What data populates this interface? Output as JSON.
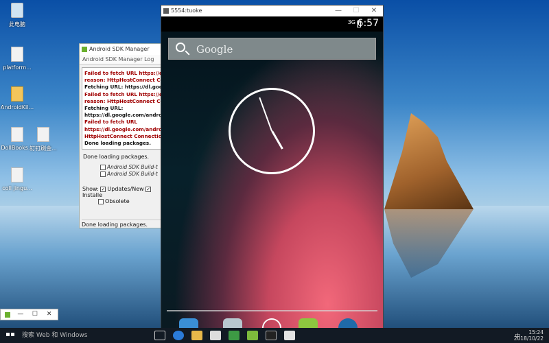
{
  "desktop": {
    "icons": [
      {
        "label": "此电脑",
        "icon": "recycle-bin-icon"
      },
      {
        "label": "platform...",
        "icon": "file-icon"
      },
      {
        "label": "AndroidKil...",
        "icon": "folder-icon"
      },
      {
        "label": "DollBooks...",
        "icon": "file-icon"
      },
      {
        "label": "钉钉刷金...",
        "icon": "file-icon"
      },
      {
        "label": "coll jingu...",
        "icon": "file-icon"
      }
    ]
  },
  "sdk_manager": {
    "title": "Android SDK Manager",
    "log_title": "Android SDK Manager Log",
    "log_lines": [
      {
        "text": "Failed to fetch URL https://dl.google.",
        "type": "err"
      },
      {
        "text": "reason: HttpHostConnect Connect",
        "type": "err"
      },
      {
        "text": "Fetching URL: https://dl.google.c",
        "type": "ok"
      },
      {
        "text": "Failed to fetch URL https://dl.goog",
        "type": "err"
      },
      {
        "text": "reason: HttpHostConnect Connec",
        "type": "err"
      },
      {
        "text": "Fetching URL:",
        "type": "ok"
      },
      {
        "text": "https://dl.google.com/android/r",
        "type": "ok"
      },
      {
        "text": "Failed to fetch URL",
        "type": "err"
      },
      {
        "text": "https://dl.google.com/android/r",
        "type": "err"
      },
      {
        "text": "HttpHostConnect Connection to",
        "type": "err"
      },
      {
        "text": "Done loading packages.",
        "type": "ok"
      }
    ],
    "status_text": "Done loading packages.",
    "list_items": [
      "Android SDK Build-t",
      "Android SDK Build-t"
    ],
    "show_label": "Show:",
    "updates_label": "Updates/New",
    "installed_label": "Installe",
    "obsolete_label": "Obsolete",
    "bottom_status": "Done loading packages."
  },
  "mini_window": {
    "minimize": "—",
    "maximize": "☐",
    "close": "✕"
  },
  "emulator": {
    "title": "5554:tuoke",
    "controls": {
      "minimize": "—",
      "maximize": "☐",
      "close": "✕"
    },
    "status": {
      "network": "3G",
      "time": "6:57"
    },
    "search_text": "Google",
    "clock": {
      "hour_deg": 150,
      "minute_deg": -20
    }
  },
  "taskbar": {
    "search_placeholder": "搜索 Web 和 Windows",
    "time": "15:24",
    "date": "2018/10/22",
    "lang": "中"
  }
}
